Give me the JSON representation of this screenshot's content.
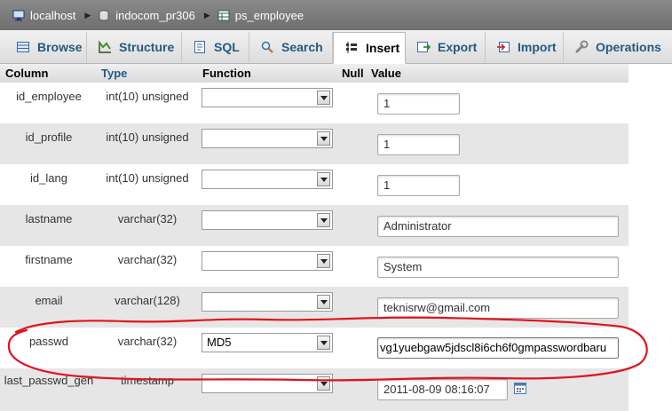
{
  "breadcrumb": {
    "server": "localhost",
    "database": "indocom_pr306",
    "table": "ps_employee"
  },
  "tabs": [
    {
      "label": "Browse",
      "icon": "browse-icon"
    },
    {
      "label": "Structure",
      "icon": "structure-icon"
    },
    {
      "label": "SQL",
      "icon": "sql-icon"
    },
    {
      "label": "Search",
      "icon": "search-icon"
    },
    {
      "label": "Insert",
      "icon": "insert-icon",
      "active": true
    },
    {
      "label": "Export",
      "icon": "export-icon"
    },
    {
      "label": "Import",
      "icon": "import-icon"
    },
    {
      "label": "Operations",
      "icon": "wrench-icon"
    }
  ],
  "columns_header": {
    "column": "Column",
    "type": "Type",
    "function": "Function",
    "null": "Null",
    "value": "Value"
  },
  "rows": [
    {
      "name": "id_employee",
      "type": "int(10) unsigned",
      "function": "",
      "value": "1"
    },
    {
      "name": "id_profile",
      "type": "int(10) unsigned",
      "function": "",
      "value": "1"
    },
    {
      "name": "id_lang",
      "type": "int(10) unsigned",
      "function": "",
      "value": "1"
    },
    {
      "name": "lastname",
      "type": "varchar(32)",
      "function": "",
      "value": "Administrator"
    },
    {
      "name": "firstname",
      "type": "varchar(32)",
      "function": "",
      "value": "System"
    },
    {
      "name": "email",
      "type": "varchar(128)",
      "function": "",
      "value": "teknisrw@gmail.com"
    },
    {
      "name": "passwd",
      "type": "varchar(32)",
      "function": "MD5",
      "value": "vg1yuebgaw5jdscl8i6ch6f0gmpasswordbaru"
    },
    {
      "name": "last_passwd_gen",
      "type": "timestamp",
      "function": "",
      "value": "2011-08-09 08:16:07"
    }
  ],
  "colors": {
    "tab_link": "#235a81",
    "annotation": "#e0141e"
  }
}
